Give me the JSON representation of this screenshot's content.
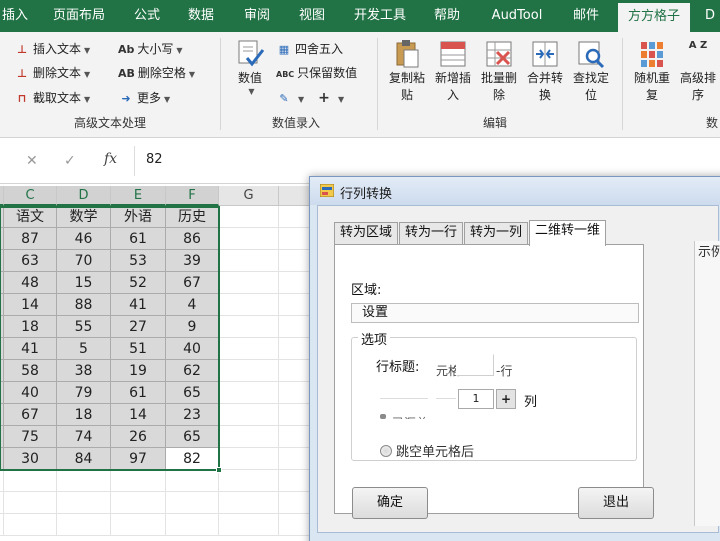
{
  "ribbon_tabs": [
    {
      "label": "插入",
      "active": false
    },
    {
      "label": "页面布局",
      "active": false
    },
    {
      "label": "公式",
      "active": false
    },
    {
      "label": "数据",
      "active": false
    },
    {
      "label": "审阅",
      "active": false
    },
    {
      "label": "视图",
      "active": false
    },
    {
      "label": "开发工具",
      "active": false
    },
    {
      "label": "帮助",
      "active": false
    },
    {
      "label": "AudTool",
      "active": false
    },
    {
      "label": "邮件",
      "active": false
    },
    {
      "label": "方方格子",
      "active": true
    },
    {
      "label": "D",
      "active": false
    }
  ],
  "ribbon": {
    "text_group": {
      "insert_text": "插入文本",
      "delete_text": "删除文本",
      "truncate_text": "截取文本",
      "case": "大小写",
      "delete_spaces": "删除空格",
      "more": "更多",
      "group_label": "高级文本处理",
      "case_icon_text": "Ab",
      "delete_spaces_icon_text": "AB"
    },
    "number_group": {
      "value": "数值",
      "round": "四舍五入",
      "keep_value": "只保留数值",
      "group_label": "数值录入",
      "keep_value_icon_text": "ABC"
    },
    "edit_group": {
      "buttons": [
        {
          "line1": "复制粘",
          "line2": "贴"
        },
        {
          "line1": "新增插",
          "line2": "入"
        },
        {
          "line1": "批量删",
          "line2": "除"
        },
        {
          "line1": "合并转",
          "line2": "换"
        },
        {
          "line1": "查找定",
          "line2": "位"
        }
      ],
      "group_label": "编辑"
    },
    "sort_group": {
      "buttons": [
        {
          "line1": "随机重",
          "line2": "复"
        },
        {
          "line1": "高级排",
          "line2": "序"
        }
      ],
      "group_label_partial": "数",
      "sort_icon_text": "A Z"
    }
  },
  "formula_bar": {
    "cancel_icon": "✕",
    "enter_icon": "✓",
    "fx_label": "fx",
    "value": "82"
  },
  "sheet": {
    "columns": [
      "C",
      "D",
      "E",
      "F",
      "G"
    ],
    "header_row": [
      "语文",
      "数学",
      "外语",
      "历史"
    ],
    "rows": [
      [
        87,
        46,
        61,
        86
      ],
      [
        63,
        70,
        53,
        39
      ],
      [
        48,
        15,
        52,
        67
      ],
      [
        14,
        88,
        41,
        4
      ],
      [
        18,
        55,
        27,
        9
      ],
      [
        41,
        5,
        51,
        40
      ],
      [
        58,
        38,
        19,
        62
      ],
      [
        40,
        79,
        61,
        65
      ],
      [
        67,
        18,
        14,
        23
      ],
      [
        75,
        74,
        26,
        65
      ],
      [
        30,
        84,
        97,
        82
      ]
    ]
  },
  "dialog": {
    "title": "行列转换",
    "tabs": [
      {
        "label": "转为区域",
        "active": false
      },
      {
        "label": "转为一行",
        "active": false
      },
      {
        "label": "转为一列",
        "active": false
      },
      {
        "label": "二维转一维",
        "active": true
      }
    ],
    "range_label": "区域:",
    "range_value": "设置",
    "options_legend": "选项",
    "row_title_label": "行标题:",
    "row_title_cell_text": "元格",
    "row_title_suffix": "-行",
    "column_count": "1",
    "plus_label": "+",
    "column_suffix": "列",
    "skip_empty_label": "跳空单元格后",
    "ok_button": "确定",
    "exit_button": "退出",
    "side_label": "示例"
  },
  "colors": {
    "excel_green": "#217346",
    "selected_cell_fill": "#d9d9d9",
    "dialog_frame": "#dbe6f3"
  }
}
